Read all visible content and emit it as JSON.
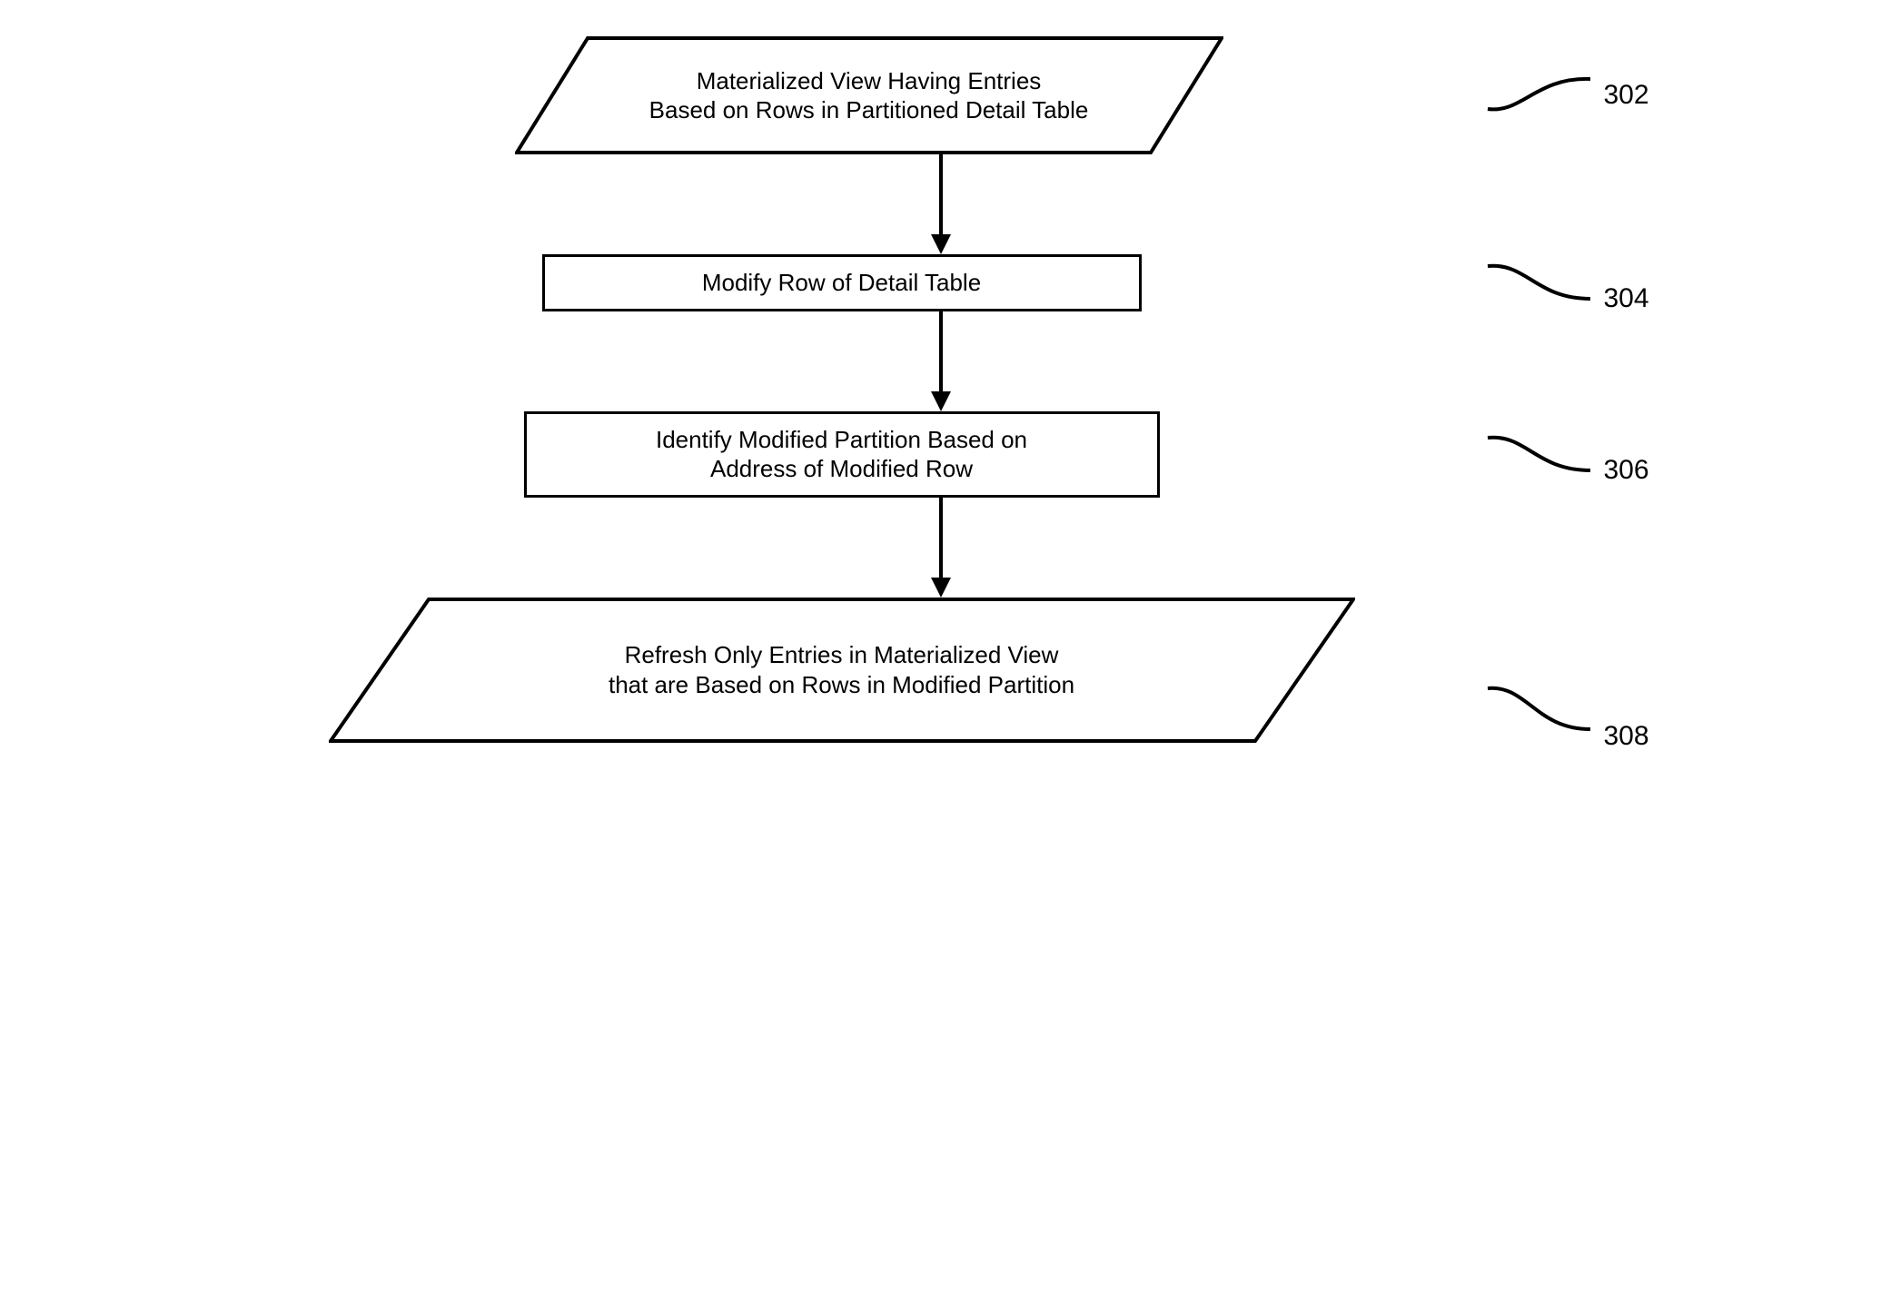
{
  "flow": {
    "node1": {
      "line1": "Materialized View Having Entries",
      "line2": "Based on Rows in Partitioned Detail Table",
      "ref": "302"
    },
    "node2": {
      "text": "Modify Row of Detail Table",
      "ref": "304"
    },
    "node3": {
      "line1": "Identify Modified Partition Based on",
      "line2": "Address of Modified Row",
      "ref": "306"
    },
    "node4": {
      "line1": "Refresh Only Entries in Materialized View",
      "line2": "that are Based on Rows in Modified Partition",
      "ref": "308"
    }
  }
}
